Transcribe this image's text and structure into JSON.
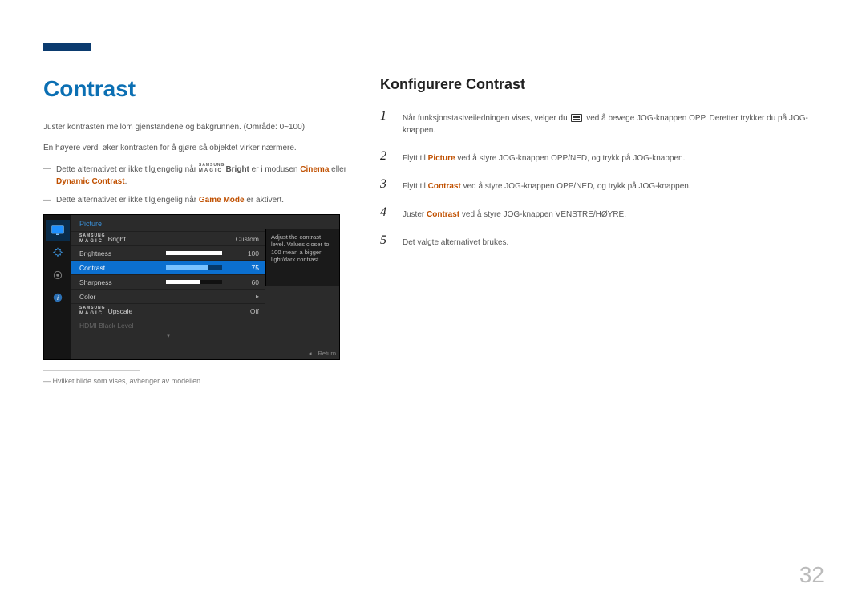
{
  "heading": "Contrast",
  "intro1": "Juster kontrasten mellom gjenstandene og bakgrunnen. (Område: 0~100)",
  "intro2": "En høyere verdi øker kontrasten for å gjøre så objektet virker nærmere.",
  "note1_a": "Dette alternativet er ikke tilgjengelig når ",
  "note1_bright": "Bright",
  "note1_b": " er i modusen ",
  "note1_c": "Cinema",
  "note1_d": " eller ",
  "note1_e": "Dynamic Contrast",
  "note1_f": ".",
  "note2_a": "Dette alternativet er ikke tilgjengelig når ",
  "note2_b": "Game Mode",
  "note2_c": " er aktivert.",
  "osd": {
    "title": "Picture",
    "rows": {
      "magic_bright": {
        "label": "Bright",
        "value": "Custom"
      },
      "brightness": {
        "label": "Brightness",
        "value": "100",
        "pct": 100
      },
      "contrast": {
        "label": "Contrast",
        "value": "75",
        "pct": 75
      },
      "sharpness": {
        "label": "Sharpness",
        "value": "60",
        "pct": 60
      },
      "color": {
        "label": "Color"
      },
      "magic_upscale": {
        "label": "Upscale",
        "value": "Off"
      },
      "hdmi": {
        "label": "HDMI Black Level"
      }
    },
    "tip": "Adjust the contrast level. Values closer to 100 mean a bigger light/dark contrast.",
    "return": "Return"
  },
  "footnote_dash": "―",
  "footnote": "Hvilket bilde som vises, avhenger av modellen.",
  "subtitle": "Konfigurere Contrast",
  "steps": {
    "s1_a": "Når funksjonstastveiledningen vises, velger du ",
    "s1_b": " ved å bevege JOG-knappen OPP. Deretter trykker du på JOG-knappen.",
    "s2_a": "Flytt til ",
    "s2_b": "Picture",
    "s2_c": " ved å styre JOG-knappen OPP/NED, og trykk på JOG-knappen.",
    "s3_a": "Flytt til ",
    "s3_b": "Contrast",
    "s3_c": " ved å styre JOG-knappen OPP/NED, og trykk på JOG-knappen.",
    "s4_a": "Juster ",
    "s4_b": "Contrast",
    "s4_c": " ved å styre JOG-knappen VENSTRE/HØYRE.",
    "s5": "Det valgte alternativet brukes."
  },
  "page_number": "32"
}
